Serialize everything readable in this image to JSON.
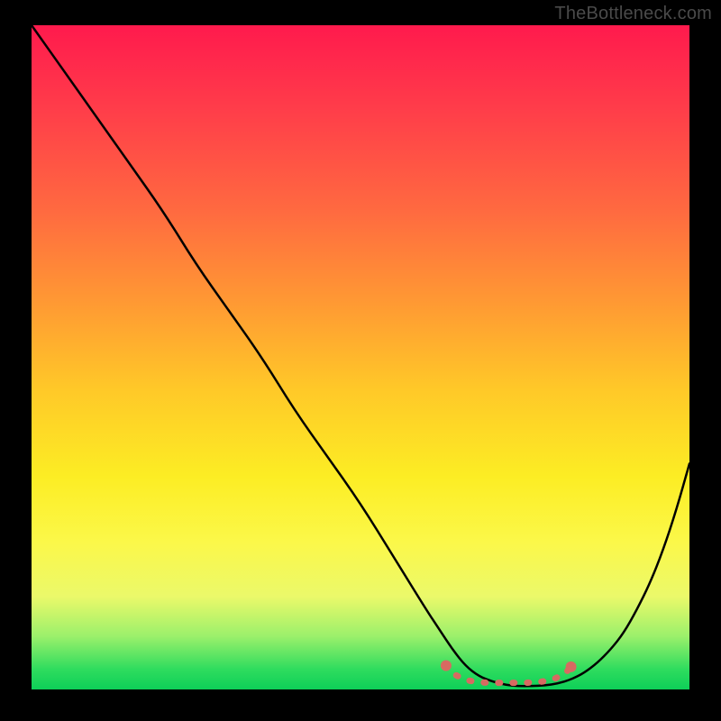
{
  "watermark": "TheBottleneck.com",
  "chart_data": {
    "type": "line",
    "title": "",
    "xlabel": "",
    "ylabel": "",
    "xlim": [
      0,
      100
    ],
    "ylim": [
      0,
      100
    ],
    "series": [
      {
        "name": "curve",
        "x": [
          0,
          5,
          10,
          15,
          20,
          25,
          30,
          35,
          40,
          45,
          50,
          55,
          60,
          62,
          64,
          66,
          68,
          70,
          72,
          74,
          76,
          78,
          80,
          82,
          84,
          86,
          88,
          90,
          92,
          94,
          96,
          98,
          100
        ],
        "y": [
          100,
          93,
          86,
          79,
          72,
          64,
          57,
          50,
          42,
          35,
          28,
          20,
          12,
          9,
          6,
          3.5,
          2,
          1.2,
          0.7,
          0.5,
          0.5,
          0.6,
          0.9,
          1.5,
          2.5,
          4,
          6,
          8.5,
          12,
          16,
          21,
          27,
          34
        ]
      }
    ],
    "markers": {
      "name": "optimum-band",
      "color": "#d76a61",
      "points": [
        {
          "x": 63,
          "y": 3.6
        },
        {
          "x": 64,
          "y": 2.4
        },
        {
          "x": 66,
          "y": 1.4
        },
        {
          "x": 68,
          "y": 1.1
        },
        {
          "x": 69.5,
          "y": 1.0
        },
        {
          "x": 71,
          "y": 1.0
        },
        {
          "x": 73,
          "y": 1.0
        },
        {
          "x": 75,
          "y": 1.0
        },
        {
          "x": 77,
          "y": 1.1
        },
        {
          "x": 79,
          "y": 1.4
        },
        {
          "x": 81,
          "y": 2.3
        },
        {
          "x": 82,
          "y": 3.4
        }
      ]
    }
  }
}
